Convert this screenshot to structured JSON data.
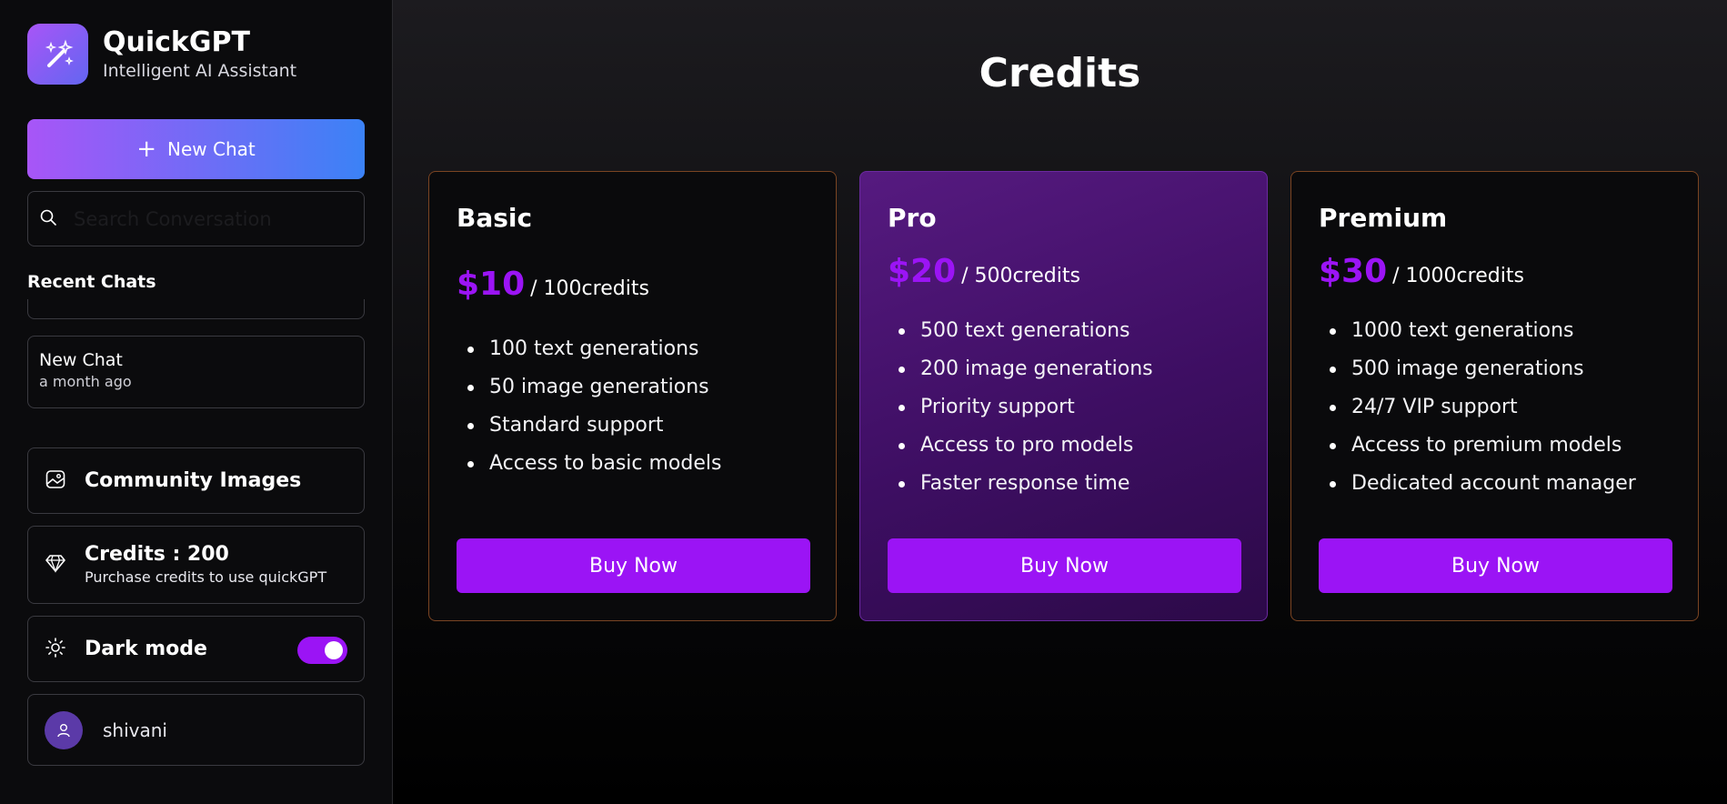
{
  "brand": {
    "name": "QuickGPT",
    "tagline": "Intelligent AI Assistant"
  },
  "sidebar": {
    "new_chat_label": "New Chat",
    "new_chat_icon": "plus-icon",
    "search_placeholder": "Search Conversation",
    "recent_title": "Recent Chats",
    "recent_chats": [
      {
        "title": "New Chat",
        "time": "a month ago"
      }
    ],
    "community_label": "Community Images",
    "credits_label": "Credits : 200",
    "credits_sub": "Purchase credits to use quickGPT",
    "dark_mode_label": "Dark mode",
    "dark_mode_on": true,
    "user_name": "shivani"
  },
  "main": {
    "title": "Credits",
    "plans": [
      {
        "name": "Basic",
        "price": "$10",
        "unit": "/ 100credits",
        "features": [
          "100 text generations",
          "50 image generations",
          "Standard support",
          "Access to basic models"
        ],
        "button": "Buy Now",
        "featured": false
      },
      {
        "name": "Pro",
        "price": "$20",
        "unit": "/ 500credits",
        "features": [
          "500 text generations",
          "200 image generations",
          "Priority support",
          "Access to pro models",
          "Faster response time"
        ],
        "button": "Buy Now",
        "featured": true
      },
      {
        "name": "Premium",
        "price": "$30",
        "unit": "/ 1000credits",
        "features": [
          "1000 text generations",
          "500 image generations",
          "24/7 VIP support",
          "Access to premium models",
          "Dedicated account manager"
        ],
        "button": "Buy Now",
        "featured": false
      }
    ]
  },
  "colors": {
    "accent": "#9b14f5",
    "gradient_start": "#a855f7",
    "gradient_end": "#3b82f6"
  }
}
